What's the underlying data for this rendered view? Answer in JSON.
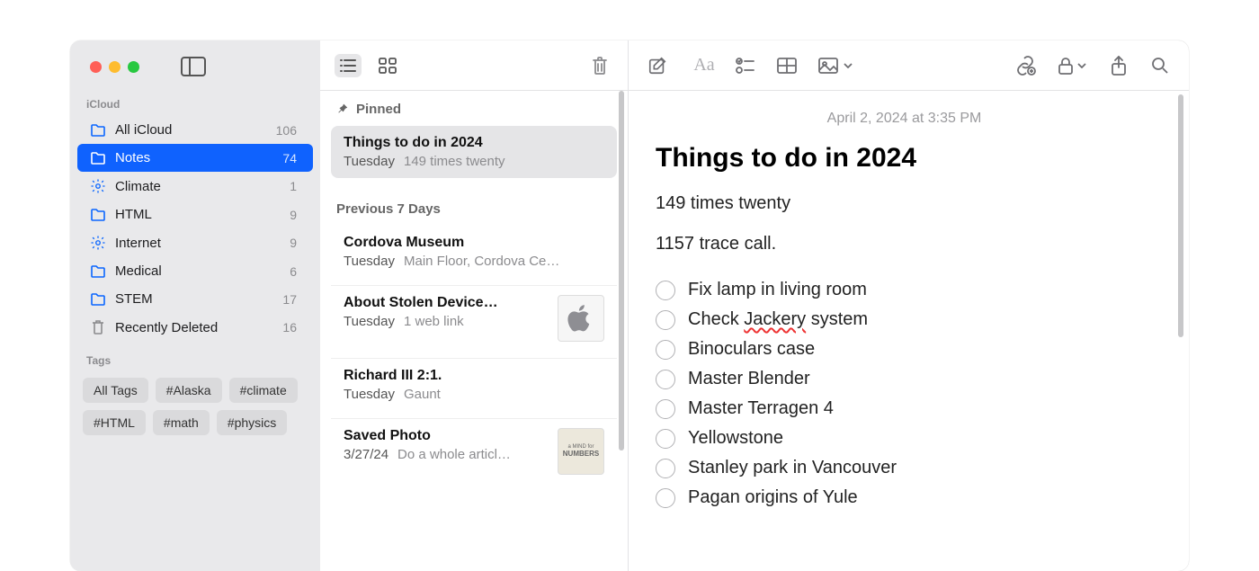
{
  "sidebar": {
    "account_label": "iCloud",
    "folders": [
      {
        "icon": "folder",
        "name": "All iCloud",
        "count": "106",
        "selected": false
      },
      {
        "icon": "folder",
        "name": "Notes",
        "count": "74",
        "selected": true
      },
      {
        "icon": "gear",
        "name": "Climate",
        "count": "1",
        "selected": false
      },
      {
        "icon": "folder",
        "name": "HTML",
        "count": "9",
        "selected": false
      },
      {
        "icon": "gear",
        "name": "Internet",
        "count": "9",
        "selected": false
      },
      {
        "icon": "folder",
        "name": "Medical",
        "count": "6",
        "selected": false
      },
      {
        "icon": "folder",
        "name": "STEM",
        "count": "17",
        "selected": false
      },
      {
        "icon": "trash",
        "name": "Recently Deleted",
        "count": "16",
        "selected": false
      }
    ],
    "tags_label": "Tags",
    "tags": [
      "All Tags",
      "#Alaska",
      "#climate",
      "#HTML",
      "#math",
      "#physics"
    ]
  },
  "notelist": {
    "pinned_label": "Pinned",
    "prev7_label": "Previous 7 Days",
    "pinned": [
      {
        "title": "Things to do in 2024",
        "date": "Tuesday",
        "preview": "149 times twenty",
        "selected": true
      }
    ],
    "recent": [
      {
        "title": "Cordova Museum",
        "date": "Tuesday",
        "preview": "Main Floor, Cordova Ce…",
        "thumb": null
      },
      {
        "title": "About Stolen Device…",
        "date": "Tuesday",
        "preview": "1 web link",
        "thumb": "apple"
      },
      {
        "title": "Richard III 2:1.",
        "date": "Tuesday",
        "preview": "Gaunt",
        "thumb": null
      },
      {
        "title": "Saved Photo",
        "date": "3/27/24",
        "preview": "Do a whole articl…",
        "thumb": "book"
      }
    ]
  },
  "editor": {
    "date": "April 2, 2024 at 3:35 PM",
    "title": "Things to do in 2024",
    "para1": "149 times twenty",
    "para2": "1157 trace call.",
    "checklist": [
      "Fix lamp in living room",
      "Check Jackery system",
      "Binoculars case",
      "Master Blender",
      "Master Terragen 4",
      "Yellowstone",
      "Stanley park in Vancouver",
      "Pagan origins of Yule"
    ],
    "misspell_word": "Jackery"
  }
}
